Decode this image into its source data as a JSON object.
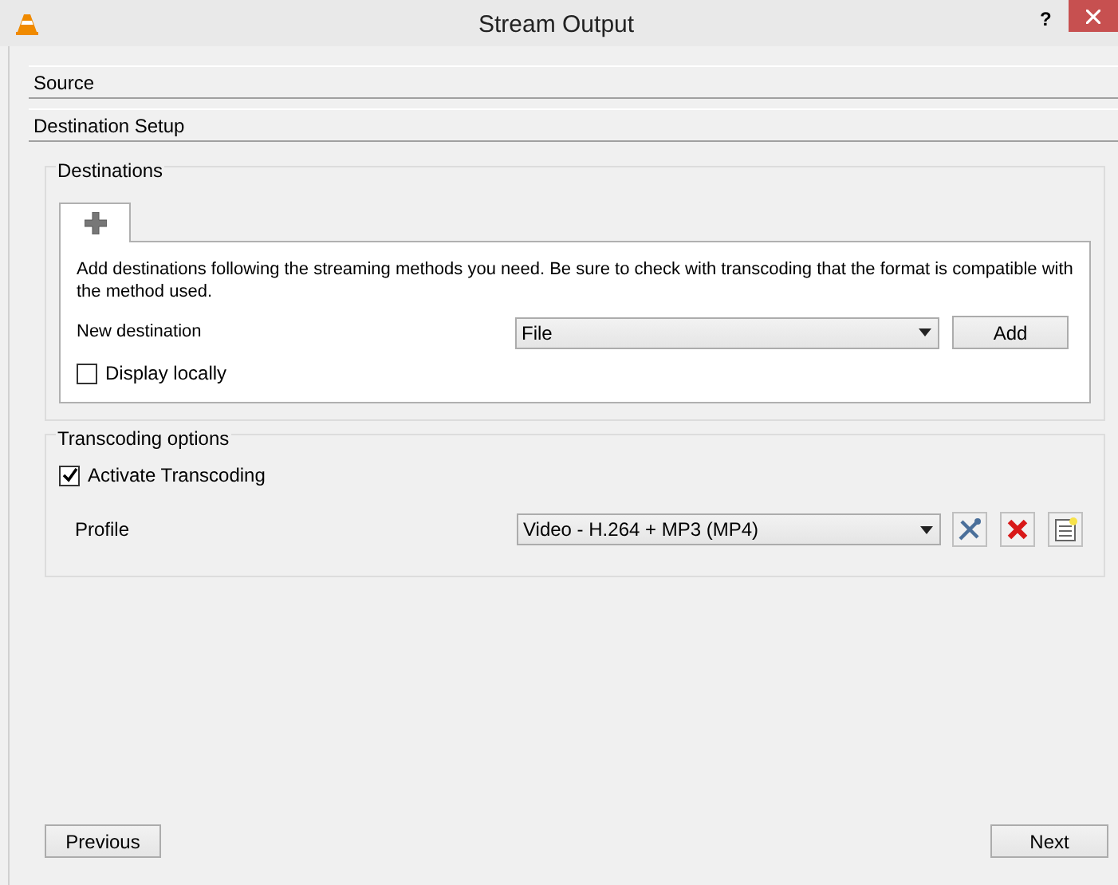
{
  "window": {
    "title": "Stream Output",
    "help": "?"
  },
  "sections": [
    {
      "label": "Source"
    },
    {
      "label": "Destination Setup"
    }
  ],
  "destinations": {
    "title": "Destinations",
    "description": "Add destinations following the streaming methods you need. Be sure to check with transcoding that the format is compatible with the method used.",
    "new_destination_label": "New destination",
    "method": "File",
    "add_button": "Add",
    "display_locally": {
      "label": "Display locally",
      "checked": false
    }
  },
  "transcoding": {
    "title": "Transcoding options",
    "activate": {
      "label": "Activate Transcoding",
      "checked": true
    },
    "profile_label": "Profile",
    "profile": "Video - H.264 + MP3 (MP4)"
  },
  "buttons": {
    "previous": "Previous",
    "next": "Next"
  }
}
